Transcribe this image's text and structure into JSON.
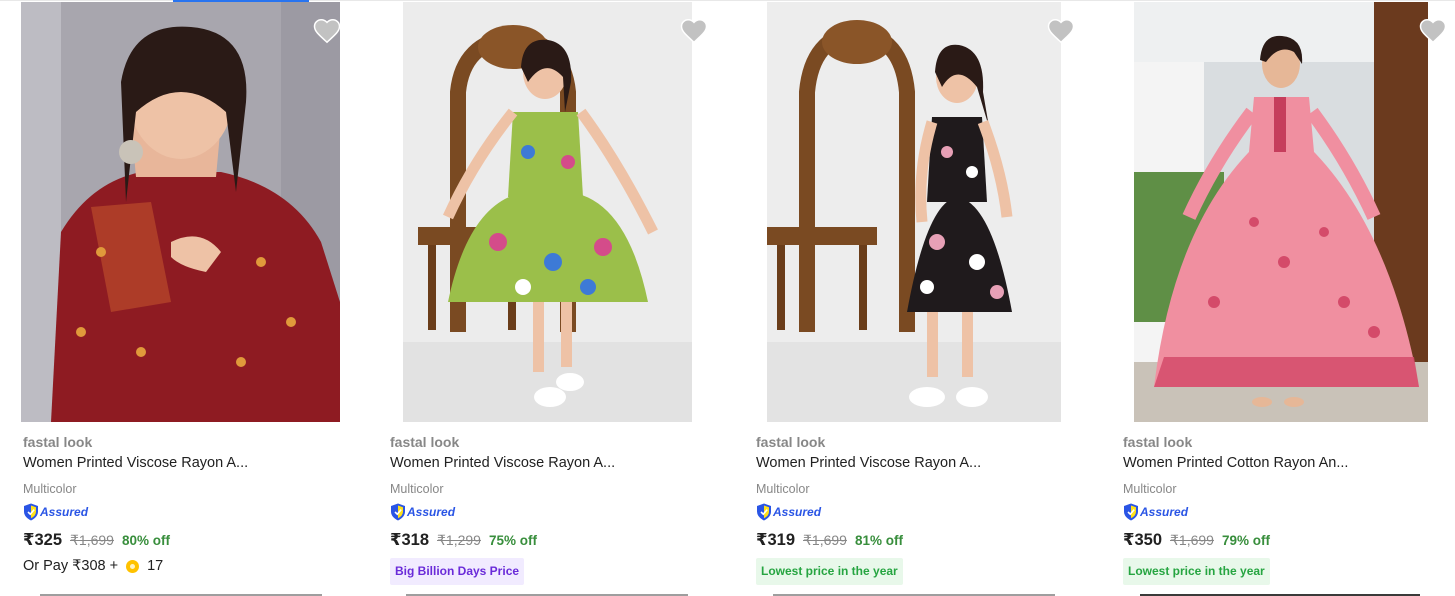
{
  "products": [
    {
      "brand": "fastal look",
      "title": "Women Printed Viscose Rayon A...",
      "color": "Multicolor",
      "assured_label": "Assured",
      "price": "₹325",
      "mrp": "₹1,699",
      "discount": "80% off",
      "pay_with_coins": {
        "prefix": "Or Pay ₹308 +",
        "coins": "17"
      },
      "image": {
        "description": "woman in maroon printed kurta",
        "dress_color": "#8e1b22",
        "bg_color": "#a5a3ab"
      }
    },
    {
      "brand": "fastal look",
      "title": "Women Printed Viscose Rayon A...",
      "color": "Multicolor",
      "assured_label": "Assured",
      "price": "₹318",
      "mrp": "₹1,299",
      "discount": "75% off",
      "tag": "Big Billion Days Price",
      "image": {
        "description": "woman in green floral strap dress beside carved mirror",
        "dress_color": "#9bbf4a",
        "bg_color": "#ececec"
      }
    },
    {
      "brand": "fastal look",
      "title": "Women Printed Viscose Rayon A...",
      "color": "Multicolor",
      "assured_label": "Assured",
      "price": "₹319",
      "mrp": "₹1,699",
      "discount": "81% off",
      "tag": "Lowest price in the year",
      "image": {
        "description": "woman in black floral strap dress beside carved mirror",
        "dress_color": "#1f1a1c",
        "bg_color": "#ededed"
      }
    },
    {
      "brand": "fastal look",
      "title": "Women Printed Cotton Rayon An...",
      "color": "Multicolor",
      "assured_label": "Assured",
      "price": "₹350",
      "mrp": "₹1,699",
      "discount": "79% off",
      "tag": "Lowest price in the year",
      "image": {
        "description": "woman in pink printed anarkali gown in courtyard",
        "dress_color": "#f08fa0",
        "bg_color": "#d9dde0"
      }
    }
  ],
  "icons": {
    "wishlist": "heart-icon",
    "assured": "shield-icon",
    "coin": "supercoin-icon"
  },
  "colors": {
    "price_text": "#212121",
    "muted": "#878787",
    "discount": "#388e3c",
    "assured": "#2a55e5",
    "bbd_tag": "#6a2bd9",
    "low_tag": "#26a541"
  }
}
